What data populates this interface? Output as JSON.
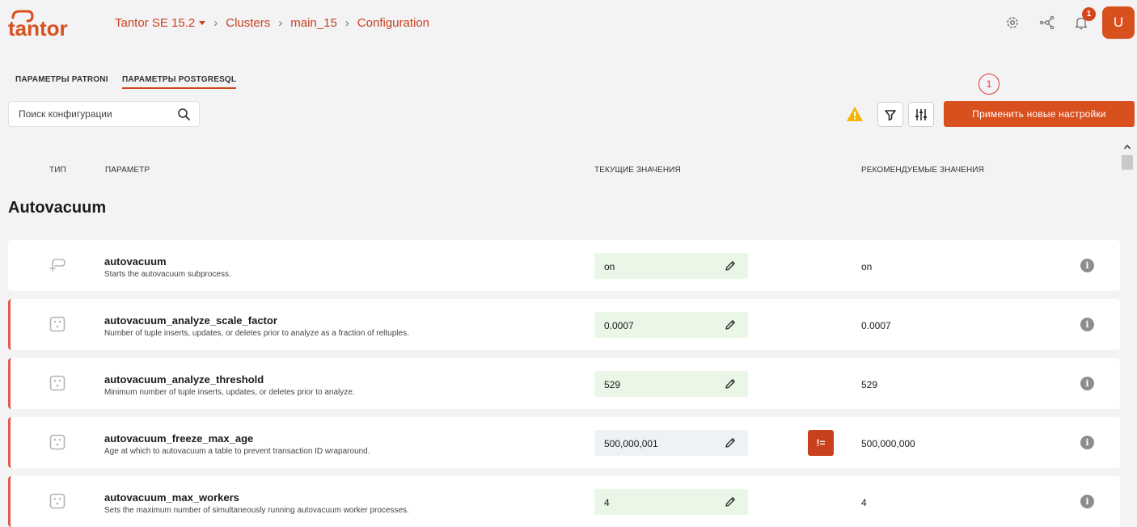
{
  "brand": {
    "name": "tantor",
    "accent": "#d9501f"
  },
  "breadcrumb": {
    "product": "Tantor SE 15.2",
    "items": [
      "Clusters",
      "main_15",
      "Configuration"
    ]
  },
  "header": {
    "icons": [
      "gear-icon",
      "network-icon",
      "bell-icon"
    ],
    "notification_count": "1",
    "avatar_initial": "U"
  },
  "tabs": [
    {
      "label": "ПАРАМЕТРЫ PATRONI",
      "active": false
    },
    {
      "label": "ПАРАМЕТРЫ POSTGRESQL",
      "active": true
    }
  ],
  "step_marker": "1",
  "search": {
    "placeholder": "Поиск конфигурации",
    "value": ""
  },
  "toolbar": {
    "apply_label": "Применить новые настройки"
  },
  "columns": {
    "type": "ТИП",
    "parameter": "ПАРАМЕТР",
    "current": "ТЕКУЩИЕ ЗНАЧЕНИЯ",
    "recommended": "РЕКОМЕНДУЕМЫЕ ЗНАЧЕНИЯ"
  },
  "section": {
    "title": "Autovacuum"
  },
  "rows": [
    {
      "name": "autovacuum",
      "desc": "Starts the autovacuum subprocess.",
      "current": "on",
      "recommended": "on",
      "type_icon": "toggle-icon",
      "modified": false,
      "mismatch": false
    },
    {
      "name": "autovacuum_analyze_scale_factor",
      "desc": "Number of tuple inserts, updates, or deletes prior to analyze as a fraction of reltuples.",
      "current": "0.0007",
      "recommended": "0.0007",
      "type_icon": "number-icon",
      "modified": true,
      "mismatch": false
    },
    {
      "name": "autovacuum_analyze_threshold",
      "desc": "Minimum number of tuple inserts, updates, or deletes prior to analyze.",
      "current": "529",
      "recommended": "529",
      "type_icon": "number-icon",
      "modified": true,
      "mismatch": false
    },
    {
      "name": "autovacuum_freeze_max_age",
      "desc": "Age at which to autovacuum a table to prevent transaction ID wraparound.",
      "current": "500,000,001",
      "recommended": "500,000,000",
      "type_icon": "number-icon",
      "modified": true,
      "mismatch": true,
      "mismatch_label": "!="
    },
    {
      "name": "autovacuum_max_workers",
      "desc": "Sets the maximum number of simultaneously running autovacuum worker processes.",
      "current": "4",
      "recommended": "4",
      "type_icon": "number-icon",
      "modified": true,
      "mismatch": false
    }
  ]
}
